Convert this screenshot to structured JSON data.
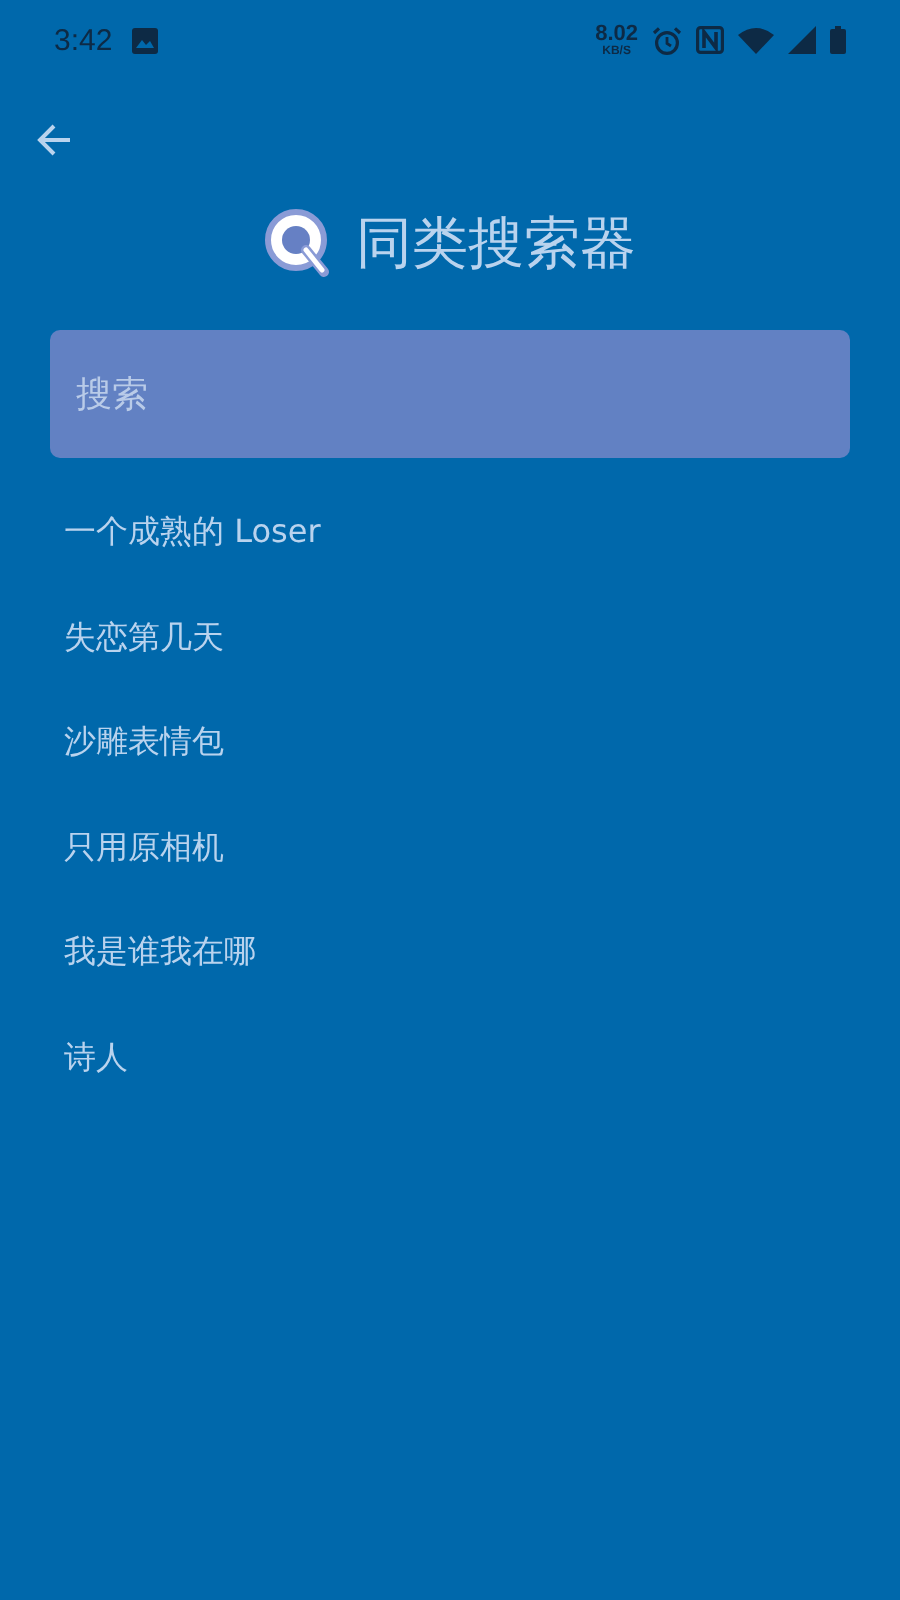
{
  "status_bar": {
    "time": "3:42",
    "net_speed": "8.02",
    "net_unit": "KB/S"
  },
  "header": {
    "title": "同类搜索器"
  },
  "search": {
    "placeholder": "搜索"
  },
  "suggestions": [
    {
      "label": "一个成熟的 Loser"
    },
    {
      "label": "失恋第几天"
    },
    {
      "label": "沙雕表情包"
    },
    {
      "label": "只用原相机"
    },
    {
      "label": "我是谁我在哪"
    },
    {
      "label": "诗人"
    }
  ]
}
